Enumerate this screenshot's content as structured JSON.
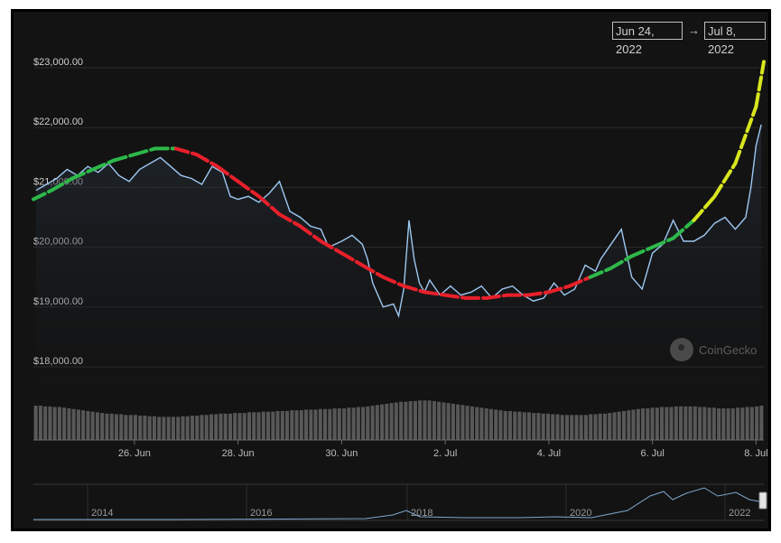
{
  "range": {
    "start": "Jun 24, 2022",
    "arrow": "→",
    "end": "Jul 8, 2022"
  },
  "watermark": "CoinGecko",
  "colors": {
    "price_line": "#9ec8f2",
    "volume": "#5a5a5a",
    "downtrend": "#e8202a",
    "uptrend_green": "#2db84a",
    "uptrend_yellow": "#d8e61e",
    "background": "#131313",
    "grid": "#2b2b2b"
  },
  "chart_data": {
    "type": "line",
    "y_tick_labels": [
      "$18,000.00",
      "$19,000.00",
      "$20,000.00",
      "$21,000.00",
      "$22,000.00",
      "$23,000.00"
    ],
    "y_ticks": [
      18000,
      19000,
      20000,
      21000,
      22000,
      23000
    ],
    "ylim": [
      17000,
      24000
    ],
    "x_tick_labels": [
      "26. Jun",
      "28. Jun",
      "30. Jun",
      "2. Jul",
      "4. Jul",
      "6. Jul",
      "8. Jul"
    ],
    "x_ticks": [
      26,
      28,
      30,
      32,
      34,
      36,
      38
    ],
    "xlim": [
      24.05,
      38.15
    ],
    "series": [
      {
        "values": [
          [
            24.1,
            20950
          ],
          [
            24.3,
            21050
          ],
          [
            24.5,
            21150
          ],
          [
            24.7,
            21300
          ],
          [
            24.9,
            21200
          ],
          [
            25.1,
            21350
          ],
          [
            25.3,
            21250
          ],
          [
            25.5,
            21400
          ],
          [
            25.7,
            21200
          ],
          [
            25.9,
            21100
          ],
          [
            26.1,
            21300
          ],
          [
            26.3,
            21400
          ],
          [
            26.5,
            21500
          ],
          [
            26.7,
            21350
          ],
          [
            26.9,
            21200
          ],
          [
            27.1,
            21150
          ],
          [
            27.3,
            21050
          ],
          [
            27.5,
            21350
          ],
          [
            27.7,
            21250
          ],
          [
            27.85,
            20850
          ],
          [
            28.0,
            20800
          ],
          [
            28.2,
            20850
          ],
          [
            28.4,
            20750
          ],
          [
            28.6,
            20900
          ],
          [
            28.8,
            21100
          ],
          [
            29.0,
            20600
          ],
          [
            29.2,
            20500
          ],
          [
            29.4,
            20350
          ],
          [
            29.6,
            20300
          ],
          [
            29.75,
            20000
          ],
          [
            30.0,
            20100
          ],
          [
            30.2,
            20200
          ],
          [
            30.4,
            20050
          ],
          [
            30.5,
            19800
          ],
          [
            30.6,
            19400
          ],
          [
            30.8,
            19000
          ],
          [
            31.0,
            19050
          ],
          [
            31.1,
            18850
          ],
          [
            31.2,
            19300
          ],
          [
            31.3,
            20450
          ],
          [
            31.4,
            19800
          ],
          [
            31.5,
            19400
          ],
          [
            31.6,
            19250
          ],
          [
            31.7,
            19450
          ],
          [
            31.9,
            19200
          ],
          [
            32.1,
            19350
          ],
          [
            32.3,
            19200
          ],
          [
            32.5,
            19250
          ],
          [
            32.7,
            19350
          ],
          [
            32.9,
            19150
          ],
          [
            33.1,
            19300
          ],
          [
            33.3,
            19350
          ],
          [
            33.5,
            19200
          ],
          [
            33.7,
            19100
          ],
          [
            33.9,
            19150
          ],
          [
            34.1,
            19400
          ],
          [
            34.3,
            19200
          ],
          [
            34.5,
            19300
          ],
          [
            34.7,
            19700
          ],
          [
            34.9,
            19600
          ],
          [
            35.0,
            19800
          ],
          [
            35.2,
            20050
          ],
          [
            35.4,
            20300
          ],
          [
            35.6,
            19500
          ],
          [
            35.8,
            19300
          ],
          [
            36.0,
            19900
          ],
          [
            36.2,
            20050
          ],
          [
            36.4,
            20450
          ],
          [
            36.6,
            20100
          ],
          [
            36.8,
            20100
          ],
          [
            37.0,
            20200
          ],
          [
            37.2,
            20400
          ],
          [
            37.4,
            20500
          ],
          [
            37.6,
            20300
          ],
          [
            37.8,
            20500
          ],
          [
            37.9,
            21000
          ],
          [
            38.0,
            21700
          ],
          [
            38.1,
            22050
          ]
        ]
      },
      {
        "values": [
          [
            24.05,
            20800
          ],
          [
            24.4,
            20950
          ],
          [
            24.8,
            21150
          ],
          [
            25.2,
            21300
          ],
          [
            25.6,
            21450
          ],
          [
            26.0,
            21550
          ],
          [
            26.4,
            21650
          ],
          [
            26.8,
            21650
          ],
          [
            27.2,
            21550
          ],
          [
            27.6,
            21350
          ],
          [
            28.0,
            21100
          ],
          [
            28.4,
            20850
          ],
          [
            28.8,
            20550
          ],
          [
            29.2,
            20350
          ],
          [
            29.6,
            20100
          ],
          [
            30.0,
            19900
          ],
          [
            30.4,
            19700
          ],
          [
            30.8,
            19500
          ],
          [
            31.2,
            19350
          ],
          [
            31.6,
            19250
          ],
          [
            32.0,
            19200
          ],
          [
            32.4,
            19150
          ],
          [
            32.8,
            19150
          ],
          [
            33.2,
            19200
          ],
          [
            33.6,
            19200
          ],
          [
            34.0,
            19250
          ],
          [
            34.4,
            19350
          ],
          [
            34.8,
            19500
          ],
          [
            35.2,
            19650
          ],
          [
            35.6,
            19850
          ],
          [
            36.0,
            20000
          ],
          [
            36.4,
            20150
          ],
          [
            36.8,
            20450
          ],
          [
            37.2,
            20850
          ],
          [
            37.6,
            21400
          ],
          [
            38.0,
            22350
          ],
          [
            38.15,
            23100
          ]
        ]
      },
      {
        "values": [
          52,
          52,
          51,
          51,
          50,
          50,
          49,
          48,
          47,
          46,
          45,
          44,
          43,
          42,
          41,
          40,
          40,
          39,
          39,
          38,
          38,
          38,
          37,
          37,
          36,
          36,
          35,
          35,
          35,
          35,
          35,
          36,
          36,
          37,
          37,
          38,
          38,
          39,
          39,
          40,
          40,
          40,
          41,
          41,
          41,
          42,
          42,
          42,
          43,
          43,
          43,
          44,
          44,
          44,
          45,
          45,
          45,
          46,
          46,
          46,
          47,
          47,
          47,
          48,
          48,
          48,
          49,
          49,
          50,
          50,
          51,
          52,
          53,
          54,
          55,
          56,
          57,
          58,
          58,
          59,
          59,
          60,
          60,
          60,
          59,
          58,
          57,
          56,
          55,
          54,
          53,
          52,
          51,
          50,
          49,
          48,
          47,
          46,
          45,
          44,
          44,
          43,
          43,
          42,
          42,
          41,
          41,
          40,
          40,
          39,
          39,
          38,
          38,
          38,
          38,
          38,
          38,
          39,
          39,
          40,
          40,
          41,
          42,
          43,
          44,
          45,
          46,
          47,
          48,
          48,
          49,
          49,
          50,
          50,
          50,
          51,
          51,
          51,
          51,
          51,
          50,
          50,
          49,
          49,
          48,
          48,
          48,
          48,
          49,
          49,
          50,
          50,
          51,
          52
        ]
      }
    ],
    "navigator_tick_labels": [
      "2014",
      "2016",
      "2018",
      "2020",
      "2022"
    ]
  }
}
